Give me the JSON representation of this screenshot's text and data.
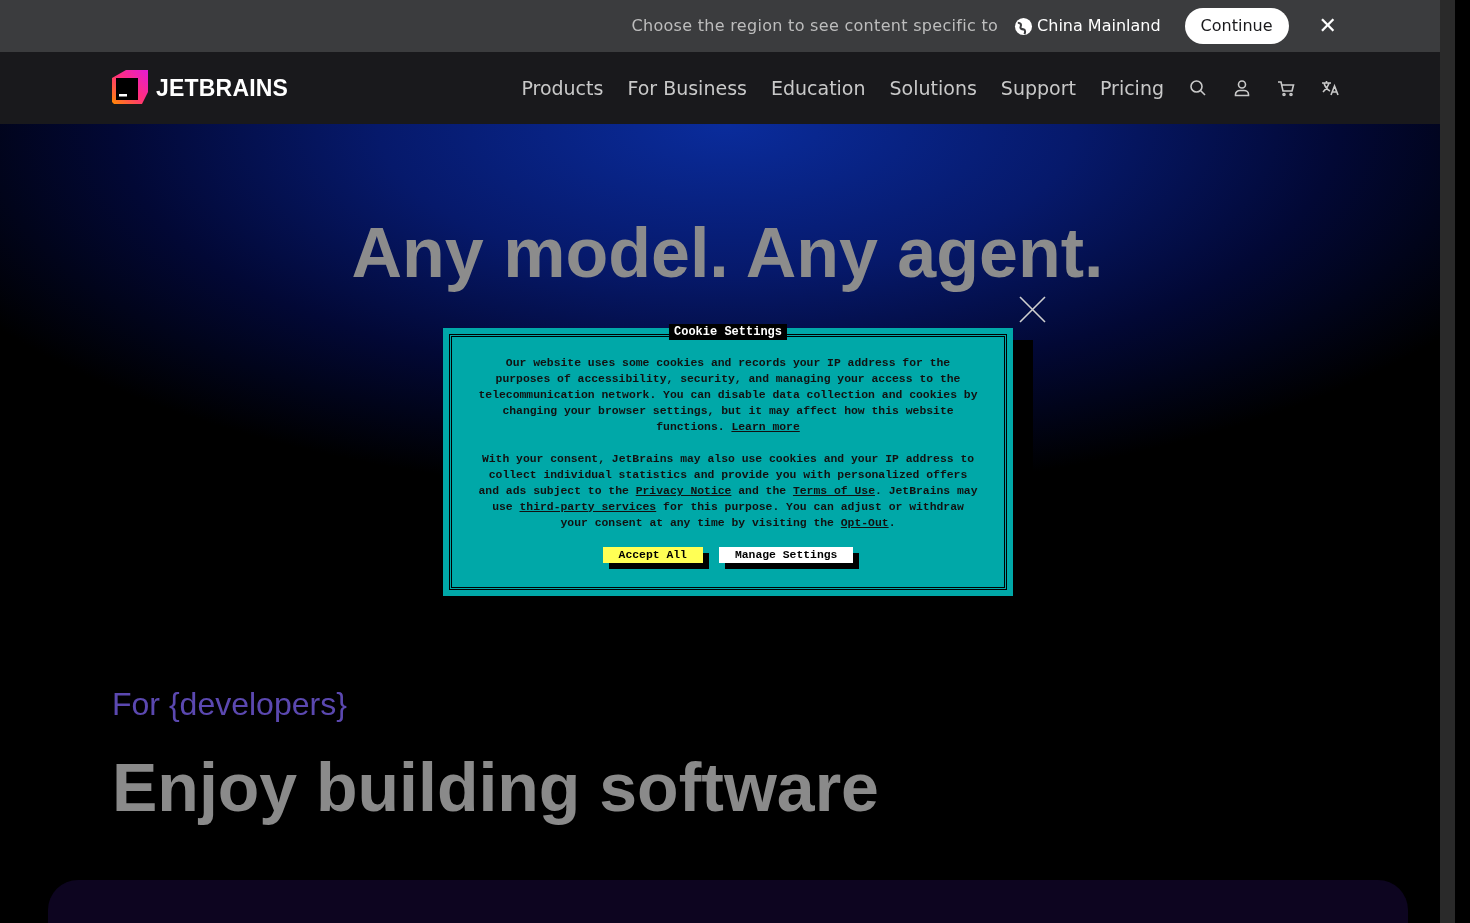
{
  "region_bar": {
    "prompt": "Choose the region to see content specific to",
    "region": "China Mainland",
    "continue_button": "Continue",
    "close": "✕"
  },
  "navbar": {
    "logo": "JETBRAINS",
    "items": [
      "Products",
      "For Business",
      "Education",
      "Solutions",
      "Support",
      "Pricing"
    ],
    "icons": [
      {
        "kind": "search"
      },
      {
        "kind": "account"
      },
      {
        "kind": "cart"
      },
      {
        "kind": "language"
      }
    ]
  },
  "hero": {
    "lines": [
      "Any model. Any agent."
    ]
  },
  "cookie_dialog": {
    "title": "Cookie Settings",
    "paragraphs": [
      [
        {
          "kind": "text",
          "text": "Our website uses some cookies and records your IP address for the purposes of accessibility, security, and managing your access to the telecommunication network. You can disable data collection and cookies by changing your browser settings, but it may affect how this website functions. "
        },
        {
          "kind": "link",
          "text": "Learn more"
        }
      ],
      [
        {
          "kind": "text",
          "text": "With your consent, JetBrains may also use cookies and your IP address to collect individual statistics and provide you with personalized offers and ads subject to the "
        },
        {
          "kind": "link",
          "text": "Privacy Notice"
        },
        {
          "kind": "text",
          "text": " and the "
        },
        {
          "kind": "link",
          "text": "Terms of Use"
        },
        {
          "kind": "text",
          "text": ". JetBrains may use "
        },
        {
          "kind": "link",
          "text": "third-party services"
        },
        {
          "kind": "text",
          "text": " for this purpose. You can adjust or withdraw your consent at any time by visiting the "
        },
        {
          "kind": "link",
          "text": "Opt-Out"
        },
        {
          "kind": "text",
          "text": "."
        }
      ]
    ],
    "buttons": [
      {
        "label": "Accept All",
        "kind": "primary"
      },
      {
        "label": "Manage Settings",
        "kind": "secondary"
      }
    ]
  },
  "section": {
    "eyebrow": "For {developers}",
    "heading": "Enjoy building software"
  }
}
